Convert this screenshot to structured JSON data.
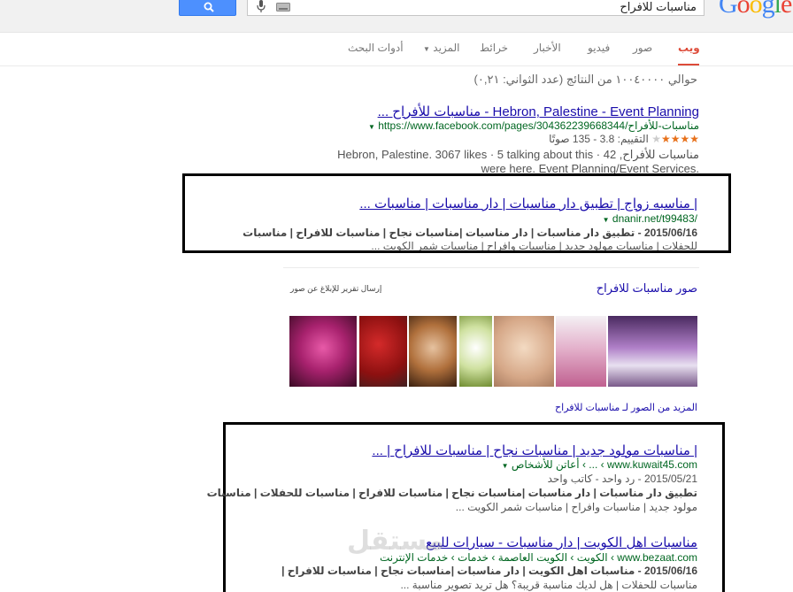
{
  "header": {
    "query": "مناسبات للافراح",
    "logo": "Google"
  },
  "tabs": [
    {
      "label": "ويب"
    },
    {
      "label": "صور"
    },
    {
      "label": "فيديو"
    },
    {
      "label": "الأخبار"
    },
    {
      "label": "خرائط"
    },
    {
      "label": "المزيد"
    },
    {
      "label": "أدوات البحث"
    }
  ],
  "stats": "حوالي ١٠٠٤٠٠٠٠ من النتائج (عدد الثواني: ٠,٢١)",
  "r1": {
    "title": "Hebron, Palestine - Event Planning - مناسبات للأفراح ...",
    "url": "https://www.facebook.com/pages/مناسبات-للأفراح/304362239668344",
    "rating": "التقييم: 3.8 - 135 صوتًا",
    "snip1": "مناسبات للأفراح, Hebron, Palestine. 3067 likes · 5 talking about this · 42",
    "snip2": "were here. Event Planning/Event Services."
  },
  "r2": {
    "title": "| مناسبه زواج | تطبيق دار مناسبات | دار مناسبات | مناسبات ...",
    "url": "dnanir.net/t99483/",
    "snip1": "2015/06/16 - تطبيق دار مناسبات | دار مناسبات |مناسبات نجاح | مناسبات للافراح | مناسبات",
    "snip2": "للحفلات | مناسبات مولود جديد | مناسبات وافراح | مناسبات شمر الكويت ..."
  },
  "images": {
    "heading": "صور مناسبات للافراح",
    "report": "إرسال تقرير للإبلاغ عن صور",
    "more": "المزيد من الصور لـ مناسبات للافراح"
  },
  "r3": {
    "title": "| مناسبات مولود جديد | مناسبات نجاح | مناسبات للافراح | ...",
    "url": "www.kuwait45.com › ... › أعاتن للأشخاص",
    "snip1": "2015/05/21 - رد واحد - كاتب واحد",
    "snip2": "تطبيق دار مناسبات | دار مناسبات |مناسبات نجاح | مناسبات للافراح | مناسبات للحفلات | مناسبات",
    "snip3": "مولود جديد | مناسبات وافراح | مناسبات شمر الكويت ..."
  },
  "r4": {
    "title": "مناسبات اهل الكويت | دار مناسبات - سيارات للبيع",
    "url": "www.bezaat.com › الكويت › الكويت العاصمة › خدمات › خدمات الإنترنت",
    "snip1": "2015/06/16 - مناسبات اهل الكويت | دار مناسبات |مناسبات نجاح | مناسبات للافراح |",
    "snip2": "مناسبات للحفلات | هل لديك مناسبة قريبة؟ هل تريد تصوير مناسبة ...",
    "watermark": "مستقل"
  },
  "colors": {
    "link": "#1a0dab",
    "url": "#006621",
    "accent": "#dd4b39",
    "button": "#4d90fe"
  }
}
